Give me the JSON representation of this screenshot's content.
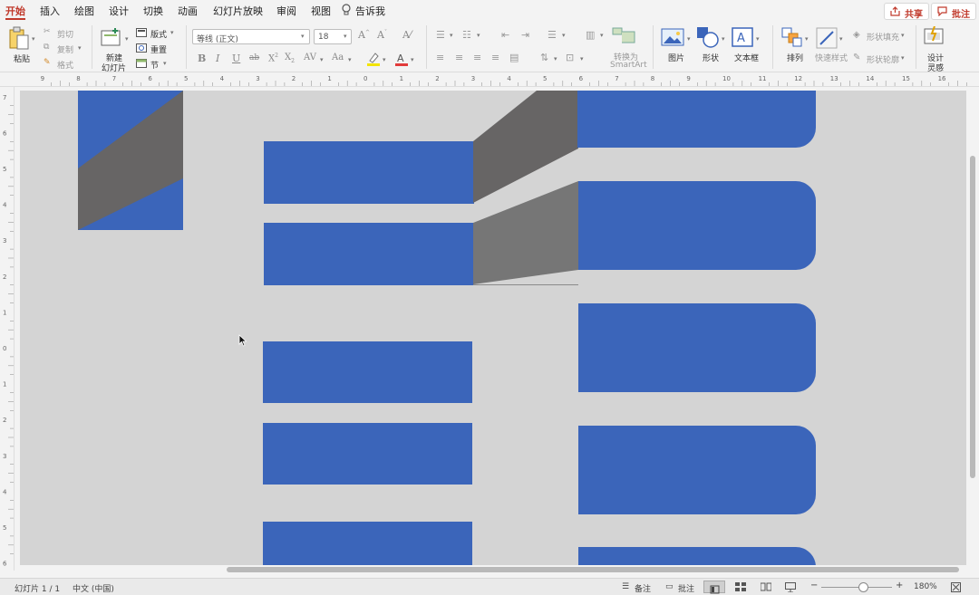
{
  "tabs": [
    "开始",
    "插入",
    "绘图",
    "设计",
    "切换",
    "动画",
    "幻灯片放映",
    "审阅",
    "视图"
  ],
  "tell_me": "告诉我",
  "share_label": "共享",
  "comment_label": "批注",
  "ribbon": {
    "paste": "粘贴",
    "cut": "剪切",
    "copy": "复制",
    "format_painter": "格式",
    "new_slide_line1": "新建",
    "new_slide_line2": "幻灯片",
    "layout": "版式",
    "reset": "重置",
    "section": "节",
    "font_name": "等线 (正文)",
    "font_size": "18",
    "convert_line1": "转换为",
    "convert_line2": "SmartArt",
    "picture": "图片",
    "shape": "形状",
    "textbox": "文本框",
    "arrange": "排列",
    "quick_styles": "快速样式",
    "shape_fill": "形状填充",
    "shape_outline": "形状轮廓",
    "designer_line1": "设计",
    "designer_line2": "灵感"
  },
  "status": {
    "slide_info": "幻灯片 1 / 1",
    "language": "中文 (中国)",
    "notes": "备注",
    "comments": "批注",
    "zoom": "180%"
  },
  "colors": {
    "accent": "#c0392b",
    "shape_blue": "#3b65ba",
    "dark_gray": "#676565",
    "mid_gray": "#767676",
    "canvas": "#d4d4d4"
  }
}
